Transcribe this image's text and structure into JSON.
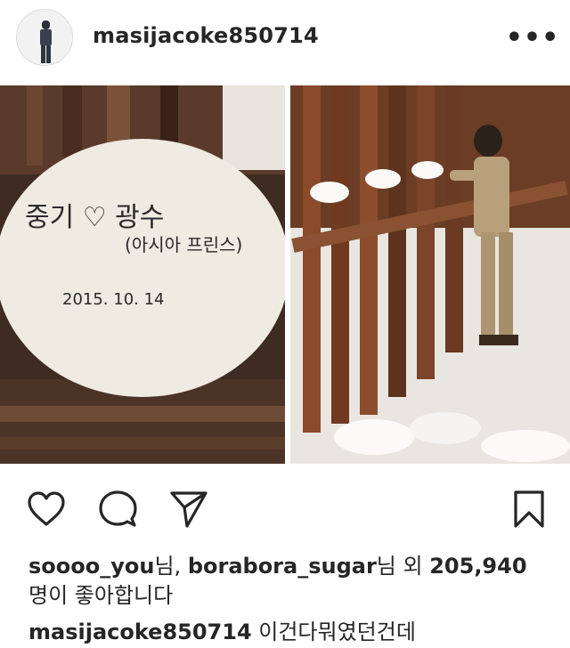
{
  "post": {
    "username": "masijacoke850714",
    "more_label": "•••"
  },
  "photo": {
    "rock_text_line1": "중기 ♡ 광수",
    "rock_text_line2": "(아시아 프린스)",
    "rock_text_date": "2015. 10. 14"
  },
  "likes": {
    "user1": "soooo_you",
    "suffix1": "님, ",
    "user2": "borabora_sugar",
    "suffix2": "님 외 ",
    "count": "205,940",
    "line2": "명이 좋아합니다"
  },
  "caption": {
    "username": "masijacoke850714",
    "text": " 이건다뭐였던건데"
  },
  "colors": {
    "text": "#262626",
    "border": "#dbdbdb"
  }
}
